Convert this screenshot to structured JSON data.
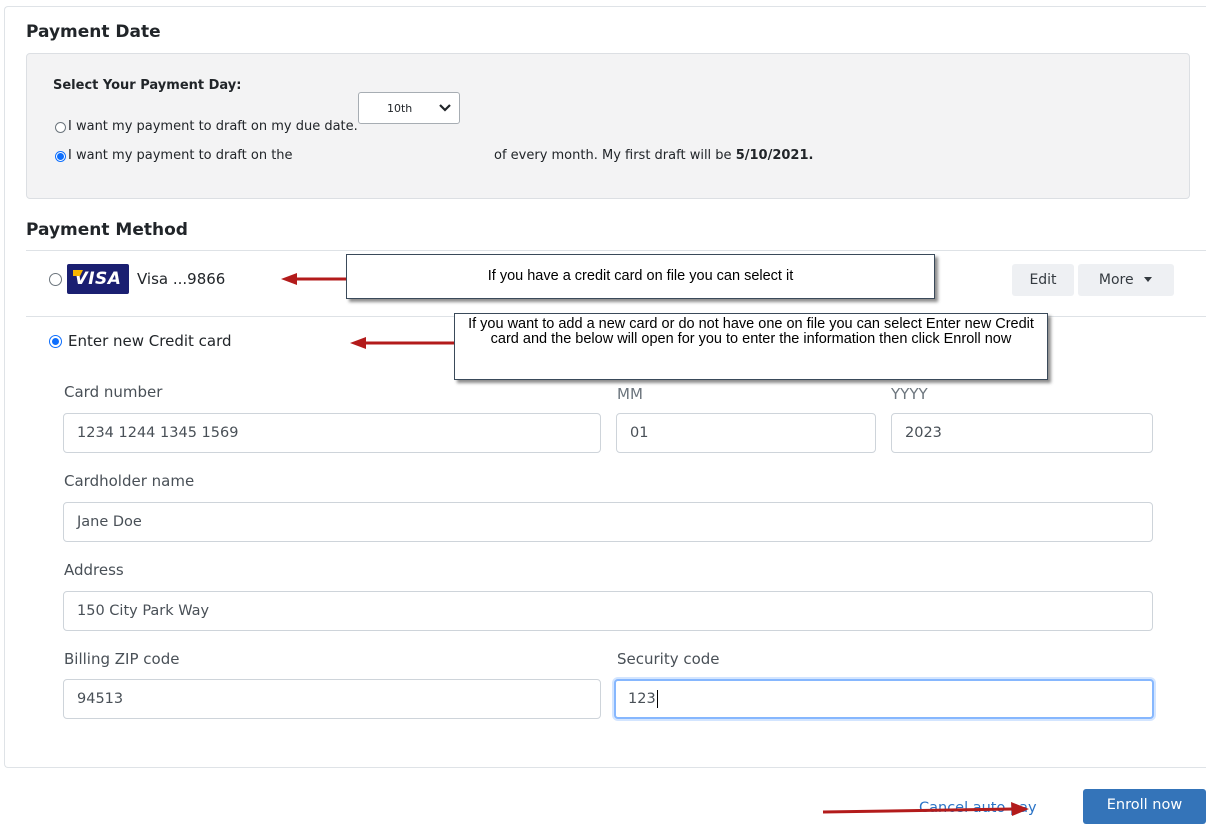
{
  "payment_date": {
    "heading": "Payment Date",
    "box_title": "Select Your Payment Day:",
    "option_due_date": "I want my payment to draft on my due date.",
    "option_day_prefix": "I want my payment to draft on the",
    "selected_day": "10th",
    "option_day_suffix": "of every month. My first draft will be",
    "first_draft_date": "5/10/2021."
  },
  "payment_method": {
    "heading": "Payment Method",
    "saved_card": {
      "brand": "VISA",
      "label": "Visa ...9866"
    },
    "edit_label": "Edit",
    "more_label": "More",
    "new_card_label": "Enter new Credit card"
  },
  "callouts": {
    "saved_card": "If you have a credit card on file you can select it",
    "new_card": "If you want to add a new card or do not have one on file you can select Enter new Credit card and the below will open for you to enter the information then click Enroll now"
  },
  "form": {
    "card_number": {
      "label": "Card number",
      "value": "1234  1244  1345  1569"
    },
    "month": {
      "label": "MM",
      "value": "01"
    },
    "year": {
      "label": "YYYY",
      "value": "2023"
    },
    "cardholder": {
      "label": "Cardholder name",
      "value": "Jane Doe"
    },
    "address": {
      "label": "Address",
      "value": "150 City Park Way"
    },
    "zip": {
      "label": "Billing ZIP code",
      "value": "94513"
    },
    "security": {
      "label": "Security code",
      "value": "123"
    }
  },
  "footer": {
    "cancel_label": "Cancel auto pay",
    "enroll_label": "Enroll now"
  },
  "colors": {
    "primary": "#3474b9",
    "link": "#2a73c6",
    "arrow": "#b31b1b",
    "visa_blue": "#1a1f71",
    "radio_checked": "#0d6efd"
  },
  "icons": [
    "chevron-down-icon",
    "caret-down-icon",
    "visa-logo",
    "arrow-icon"
  ]
}
